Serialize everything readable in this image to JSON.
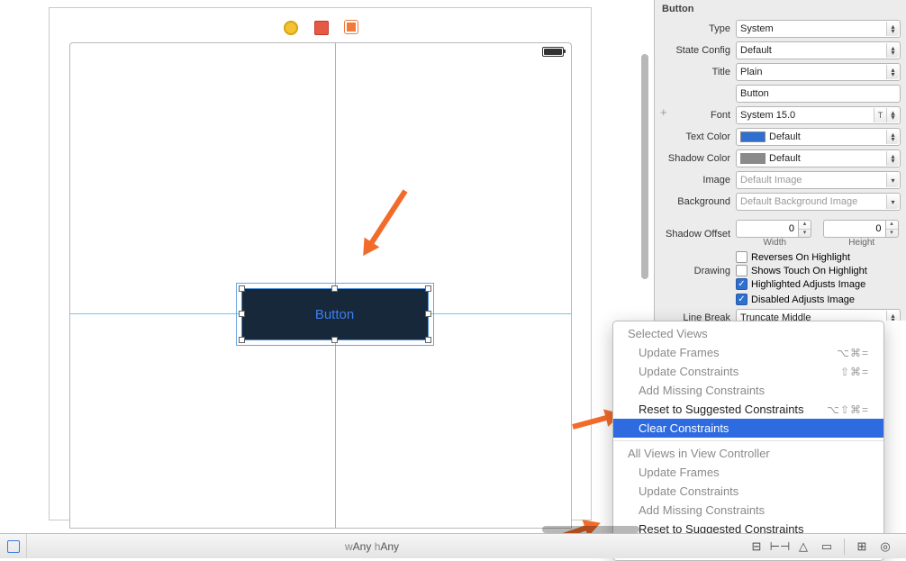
{
  "inspector": {
    "header": "Button",
    "type_label": "Type",
    "type_value": "System",
    "state_label": "State Config",
    "state_value": "Default",
    "title_label": "Title",
    "title_mode": "Plain",
    "title_value": "Button",
    "font_label": "Font",
    "font_value": "System 15.0",
    "text_color_label": "Text Color",
    "text_color_value": "Default",
    "text_color_swatch": "#2f6fd0",
    "shadow_color_label": "Shadow Color",
    "shadow_color_value": "Default",
    "shadow_color_swatch": "#8a8a8a",
    "image_label": "Image",
    "image_placeholder": "Default Image",
    "background_label": "Background",
    "background_placeholder": "Default Background Image",
    "shadow_offset_label": "Shadow Offset",
    "width_value": "0",
    "width_label": "Width",
    "height_value": "0",
    "height_label": "Height",
    "chk_reverses": "Reverses On Highlight",
    "drawing_label": "Drawing",
    "chk_shows_touch": "Shows Touch On Highlight",
    "chk_highlighted": "Highlighted Adjusts Image",
    "chk_disabled": "Disabled Adjusts Image",
    "line_break_label": "Line Break",
    "line_break_value": "Truncate Middle"
  },
  "menu": {
    "section1": "Selected Views",
    "update_frames": "Update Frames",
    "update_constraints": "Update Constraints",
    "add_missing": "Add Missing Constraints",
    "reset_suggested": "Reset to Suggested Constraints",
    "clear": "Clear Constraints",
    "section2": "All Views in View Controller",
    "shortcut_update_frames": "⌥⌘=",
    "shortcut_update_constraints": "⇧⌘=",
    "shortcut_reset": "⌥⇧⌘="
  },
  "canvas": {
    "button_text": "Button"
  },
  "bottom": {
    "size_class_w": "w",
    "size_class_any1": "Any",
    "size_class_h": " h",
    "size_class_any2": "Any"
  }
}
